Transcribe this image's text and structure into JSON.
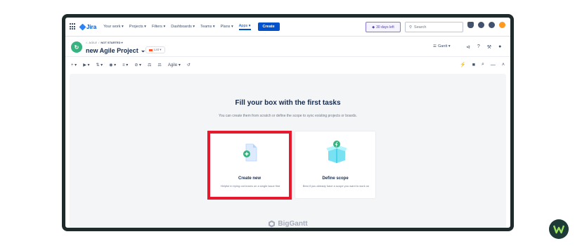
{
  "topnav": {
    "app_name": "Jira",
    "menus": [
      "Your work ▾",
      "Projects ▾",
      "Filters ▾",
      "Dashboards ▾",
      "Teams ▾",
      "Plans ▾",
      "Apps ▾"
    ],
    "active_menu_index": 6,
    "create_label": "Create",
    "trial_label": "30 days left",
    "search_placeholder": "Search",
    "icons": [
      "bell-icon",
      "help-icon",
      "settings-icon",
      "avatar"
    ]
  },
  "project": {
    "breadcrumb_project": "AGILE",
    "breadcrumb_status": "NOT STARTED ▾",
    "title": "new Agile Project",
    "view_label": "List ▾",
    "view_selector": "Gantt ▾"
  },
  "toolbar": {
    "items": [
      "+ ▾",
      "▶ ▾",
      "⇅ ▾",
      "◉ ▾",
      "≡ ▾",
      "⊘ ▾",
      "⚖",
      "⚖",
      "Agile ▾",
      "↺"
    ],
    "right_icons": [
      "⚡",
      "■",
      "⌕",
      "—",
      "˄"
    ]
  },
  "empty_state": {
    "heading": "Fill your box with the first tasks",
    "subheading": "You can create them from scratch or define the scope to sync existing projects or boards.",
    "cards": [
      {
        "title": "Create new",
        "description": "Helpful in trying out boxes on a single issue first"
      },
      {
        "title": "Define scope",
        "description": "Best if you already have a scope you want to work on"
      }
    ],
    "brand": "BigGantt"
  },
  "colors": {
    "accent": "#0052cc",
    "highlight": "#e8192c",
    "success": "#36b37e",
    "frame": "#1f2a2b"
  }
}
